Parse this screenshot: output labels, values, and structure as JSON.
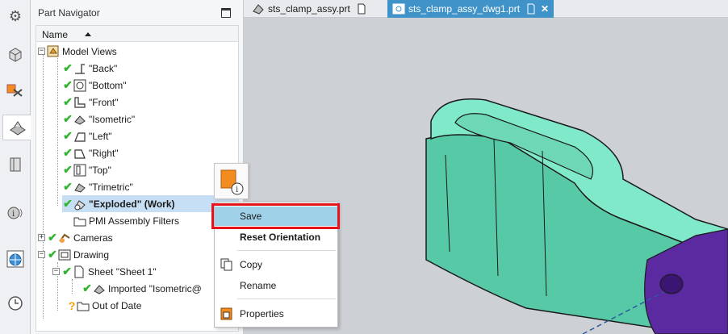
{
  "navigator": {
    "title": "Part Navigator",
    "column_name": "Name"
  },
  "tree": {
    "model_views": "Model Views",
    "views": [
      "\"Back\"",
      "\"Bottom\"",
      "\"Front\"",
      "\"Isometric\"",
      "\"Left\"",
      "\"Right\"",
      "\"Top\"",
      "\"Trimetric\""
    ],
    "exploded": "\"Exploded\" (Work)",
    "pmi": "PMI Assembly Filters",
    "cameras": "Cameras",
    "drawing": "Drawing",
    "sheet": "Sheet \"Sheet 1\"",
    "imported": "Imported \"Isometric@",
    "out_of_date": "Out of Date"
  },
  "tabs": [
    {
      "label": "sts_clamp_assy.prt",
      "active": false
    },
    {
      "label": "sts_clamp_assy_dwg1.prt",
      "active": true
    }
  ],
  "context_menu": {
    "save": "Save",
    "reset_orientation": "Reset Orientation",
    "copy": "Copy",
    "rename": "Rename",
    "properties": "Properties"
  },
  "colors": {
    "tab_active": "#3f93c8",
    "selection": "#c7dff5",
    "menu_highlight": "#9fd2e8",
    "callout": "#e3141e",
    "part_teal": "#7fe9c9",
    "part_purple": "#5b2aa0",
    "check": "#31b531"
  }
}
